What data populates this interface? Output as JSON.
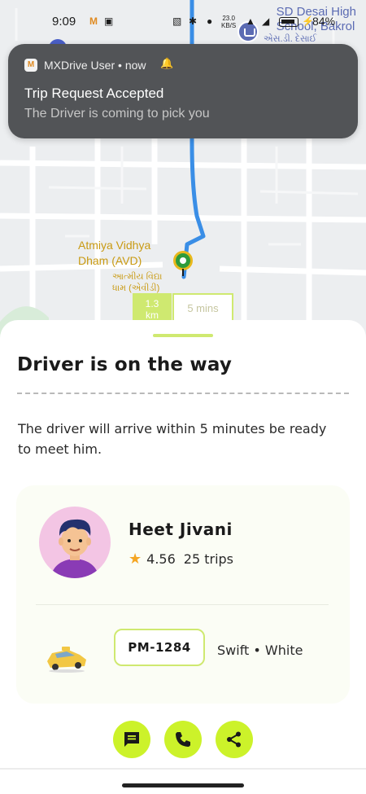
{
  "status_bar": {
    "time": "9:09",
    "network_speed": "23.0",
    "network_unit": "KB/S",
    "battery_percent": "84%"
  },
  "notification": {
    "app_name": "MXDrive User",
    "time": "now",
    "title": "Trip Request Accepted",
    "body": "The Driver is coming to pick you"
  },
  "map": {
    "poi_name_line1": "Atmiya Vidhya",
    "poi_name_line2": "Dham (AVD)",
    "poi_local_line1": "આત્મીય વિદ્યા",
    "poi_local_line2": "ધામ (એવીડી)",
    "school_line1": "SD Desai High",
    "school_line2": "School, Bakrol",
    "school_local": "એસ.ડી. દેસાઈ",
    "distance_chip": "1.3",
    "distance_chip_unit": "km",
    "eta_chip": "5 mins",
    "route_color": "#3a8ee6"
  },
  "sheet": {
    "title": "Driver is on the way",
    "description": "The driver will arrive within 5 minutes be ready to meet him."
  },
  "driver": {
    "name": "Heet Jivani",
    "rating": "4.56",
    "trips": "25 trips"
  },
  "vehicle": {
    "plate": "PM-1284",
    "model_color": "Swift • White"
  },
  "actions": {
    "chat": "chat-icon",
    "call": "phone-icon",
    "share": "share-icon"
  },
  "colors": {
    "accent": "#ccf22a",
    "accent_soft": "#cfe970",
    "notification_bg": "#525457",
    "star": "#f5a623"
  }
}
